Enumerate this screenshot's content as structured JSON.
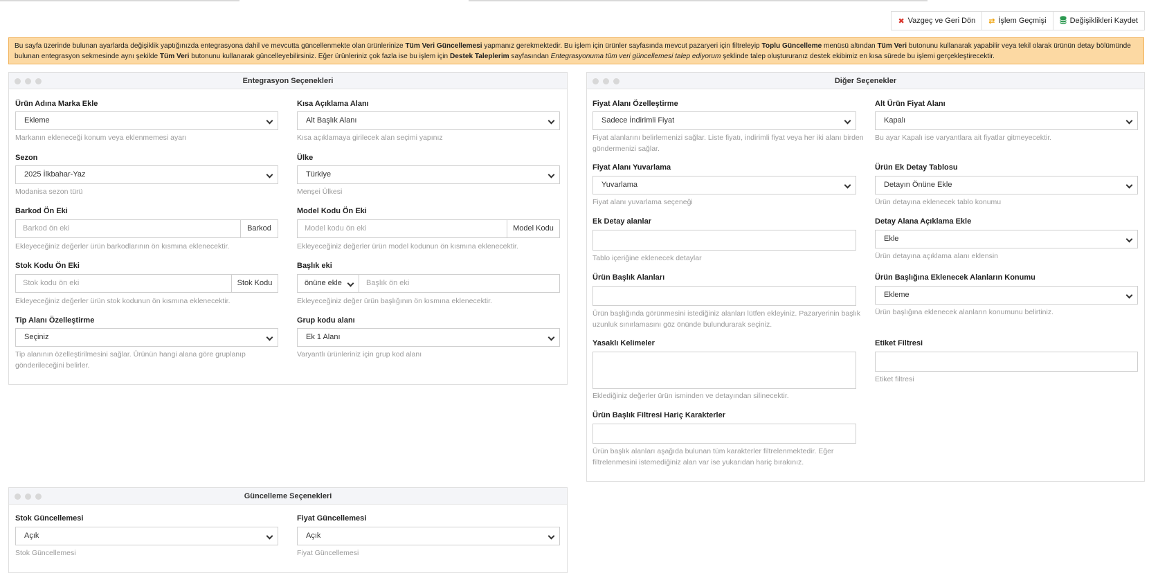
{
  "toolbar": {
    "cancel_label": "Vazgeç ve Geri Dön",
    "history_label": "İşlem Geçmişi",
    "save_label": "Değişiklikleri Kaydet",
    "colors": {
      "cancel": "#d9342b",
      "history": "#f0a30a",
      "save": "#2e9a52"
    }
  },
  "alert": {
    "t1": "Bu sayfa üzerinde bulunan ayarlarda değişiklik yaptığınızda entegrasyona dahil ve mevcutta güncellenmekte olan ürünlerinize ",
    "b1": "Tüm Veri Güncellemesi",
    "t2": " yapmanız gerekmektedir. Bu işlem için ürünler sayfasında mevcut pazaryeri için filtreleyip ",
    "b2": "Toplu Güncelleme",
    "t3": " menüsü altından ",
    "b3": "Tüm Veri",
    "t4": " butonunu kullanarak yapabilir veya tekil olarak ürünün detay bölümünde bulunan entegrasyon sekmesinde aynı şekilde ",
    "b4": "Tüm Veri",
    "t5": " butonunu kullanarak güncelleyebilirsiniz. Eğer ürünleriniz çok fazla ise bu işlem için ",
    "b5": "Destek Taleplerim",
    "t6": " sayfasından ",
    "i1": "Entegrasyonuma tüm veri güncellemesi talep ediyorum",
    "t7": " şeklinde talep oluştururanız destek ekibimiz en kısa sürede bu işlemi gerçekleştirecektir.",
    "bg": "#fcd9a3"
  },
  "integration": {
    "title": "Entegrasyon Seçenekleri",
    "brand": {
      "label": "Ürün Adına Marka Ekle",
      "value": "Ekleme",
      "help": "Markanın ekleneceği konum veya eklenmemesi ayarı"
    },
    "short_desc": {
      "label": "Kısa Açıklama Alanı",
      "value": "Alt Başlık Alanı",
      "help": "Kısa açıklamaya girilecek alan seçimi yapınız"
    },
    "season": {
      "label": "Sezon",
      "value": "2025 İlkbahar-Yaz",
      "help": "Modanisa sezon türü"
    },
    "country": {
      "label": "Ülke",
      "value": "Türkiye",
      "help": "Menşei Ülkesi"
    },
    "barcode": {
      "label": "Barkod Ön Eki",
      "placeholder": "Barkod ön eki",
      "addon": "Barkod",
      "help": "Ekleyeceğiniz değerler ürün barkodlarının ön kısmına eklenecektir."
    },
    "model": {
      "label": "Model Kodu Ön Eki",
      "placeholder": "Model kodu ön eki",
      "addon": "Model Kodu",
      "help": "Ekleyeceğiniz değerler ürün model kodunun ön kısmına eklenecektir."
    },
    "stock_code": {
      "label": "Stok Kodu Ön Eki",
      "placeholder": "Stok kodu ön eki",
      "addon": "Stok Kodu",
      "help": "Ekleyeceğiniz değerler ürün stok kodunun ön kısmına eklenecektir."
    },
    "title_prefix": {
      "label": "Başlık eki",
      "position": "önüne ekle",
      "placeholder": "Başlık ön eki",
      "help": "Ekleyeceğiniz değer ürün başlığının ön kısmına eklenecektir."
    },
    "type_field": {
      "label": "Tip Alanı Özelleştirme",
      "value": "Seçiniz",
      "help1": "Tip alanının özelleştirilmesini sağlar. Ürünün hangi alana göre gruplanıp",
      "help2": "gönderileceğini belirler."
    },
    "group_code": {
      "label": "Grup kodu alanı",
      "value": "Ek 1 Alanı",
      "help": "Varyantlı ürünleriniz için grup kod alanı"
    }
  },
  "other": {
    "title": "Diğer Seçenekler",
    "price_field": {
      "label": "Fiyat Alanı Özelleştirme",
      "value": "Sadece İndirimli Fiyat",
      "help1": "Fiyat alanlarını belirlemenizi sağlar. Liste fiyatı, indirimli fiyat veya her iki alanı birden",
      "help2": "göndermenizi sağlar."
    },
    "sub_price": {
      "label": "Alt Ürün Fiyat Alanı",
      "value": "Kapalı",
      "help": "Bu ayar Kapalı ise varyantlara ait fiyatlar gitmeyecektir."
    },
    "rounding": {
      "label": "Fiyat Alanı Yuvarlama",
      "value": "Yuvarlama",
      "help": "Fiyat alanı yuvarlama seçeneği"
    },
    "extra_table": {
      "label": "Ürün Ek Detay Tablosu",
      "value": "Detayın Önüne Ekle",
      "help": "Ürün detayına eklenecek tablo konumu"
    },
    "extra_fields": {
      "label": "Ek Detay alanlar",
      "value": "",
      "help": "Tablo içeriğine eklenecek detaylar"
    },
    "desc_add": {
      "label": "Detay Alana Açıklama Ekle",
      "value": "Ekle",
      "help": "Ürün detayına açıklama alanı eklensin"
    },
    "title_fields": {
      "label": "Ürün Başlık Alanları",
      "value": "",
      "help1": "Ürün başlığında görünmesini istediğiniz alanları lütfen ekleyiniz. Pazaryerinin başlık",
      "help2": "uzunluk sınırlamasını göz önünde bulundurarak seçiniz."
    },
    "title_pos": {
      "label": "Ürün Başlığına Eklenecek Alanların Konumu",
      "value": "Ekleme",
      "help": "Ürün başlığına eklenecek alanların konumunu belirtiniz."
    },
    "banned": {
      "label": "Yasaklı Kelimeler",
      "value": "",
      "help": "Eklediğiniz değerler ürün isminden ve detayından silinecektir."
    },
    "tag_filter": {
      "label": "Etiket Filtresi",
      "value": "",
      "help": "Etiket filtresi"
    },
    "title_filter": {
      "label": "Ürün Başlık Filtresi Hariç Karakterler",
      "value": "",
      "help1": "Ürün başlık alanları aşağıda bulunan tüm karakterler filtrelenmektedir. Eğer",
      "help2": "filtrelenmesini istemediğiniz alan var ise yukarıdan hariç bırakınız."
    }
  },
  "update": {
    "title": "Güncelleme Seçenekleri",
    "stock": {
      "label": "Stok Güncellemesi",
      "value": "Açık",
      "help": "Stok Güncellemesi"
    },
    "price": {
      "label": "Fiyat Güncellemesi",
      "value": "Açık",
      "help": "Fiyat Güncellemesi"
    }
  }
}
